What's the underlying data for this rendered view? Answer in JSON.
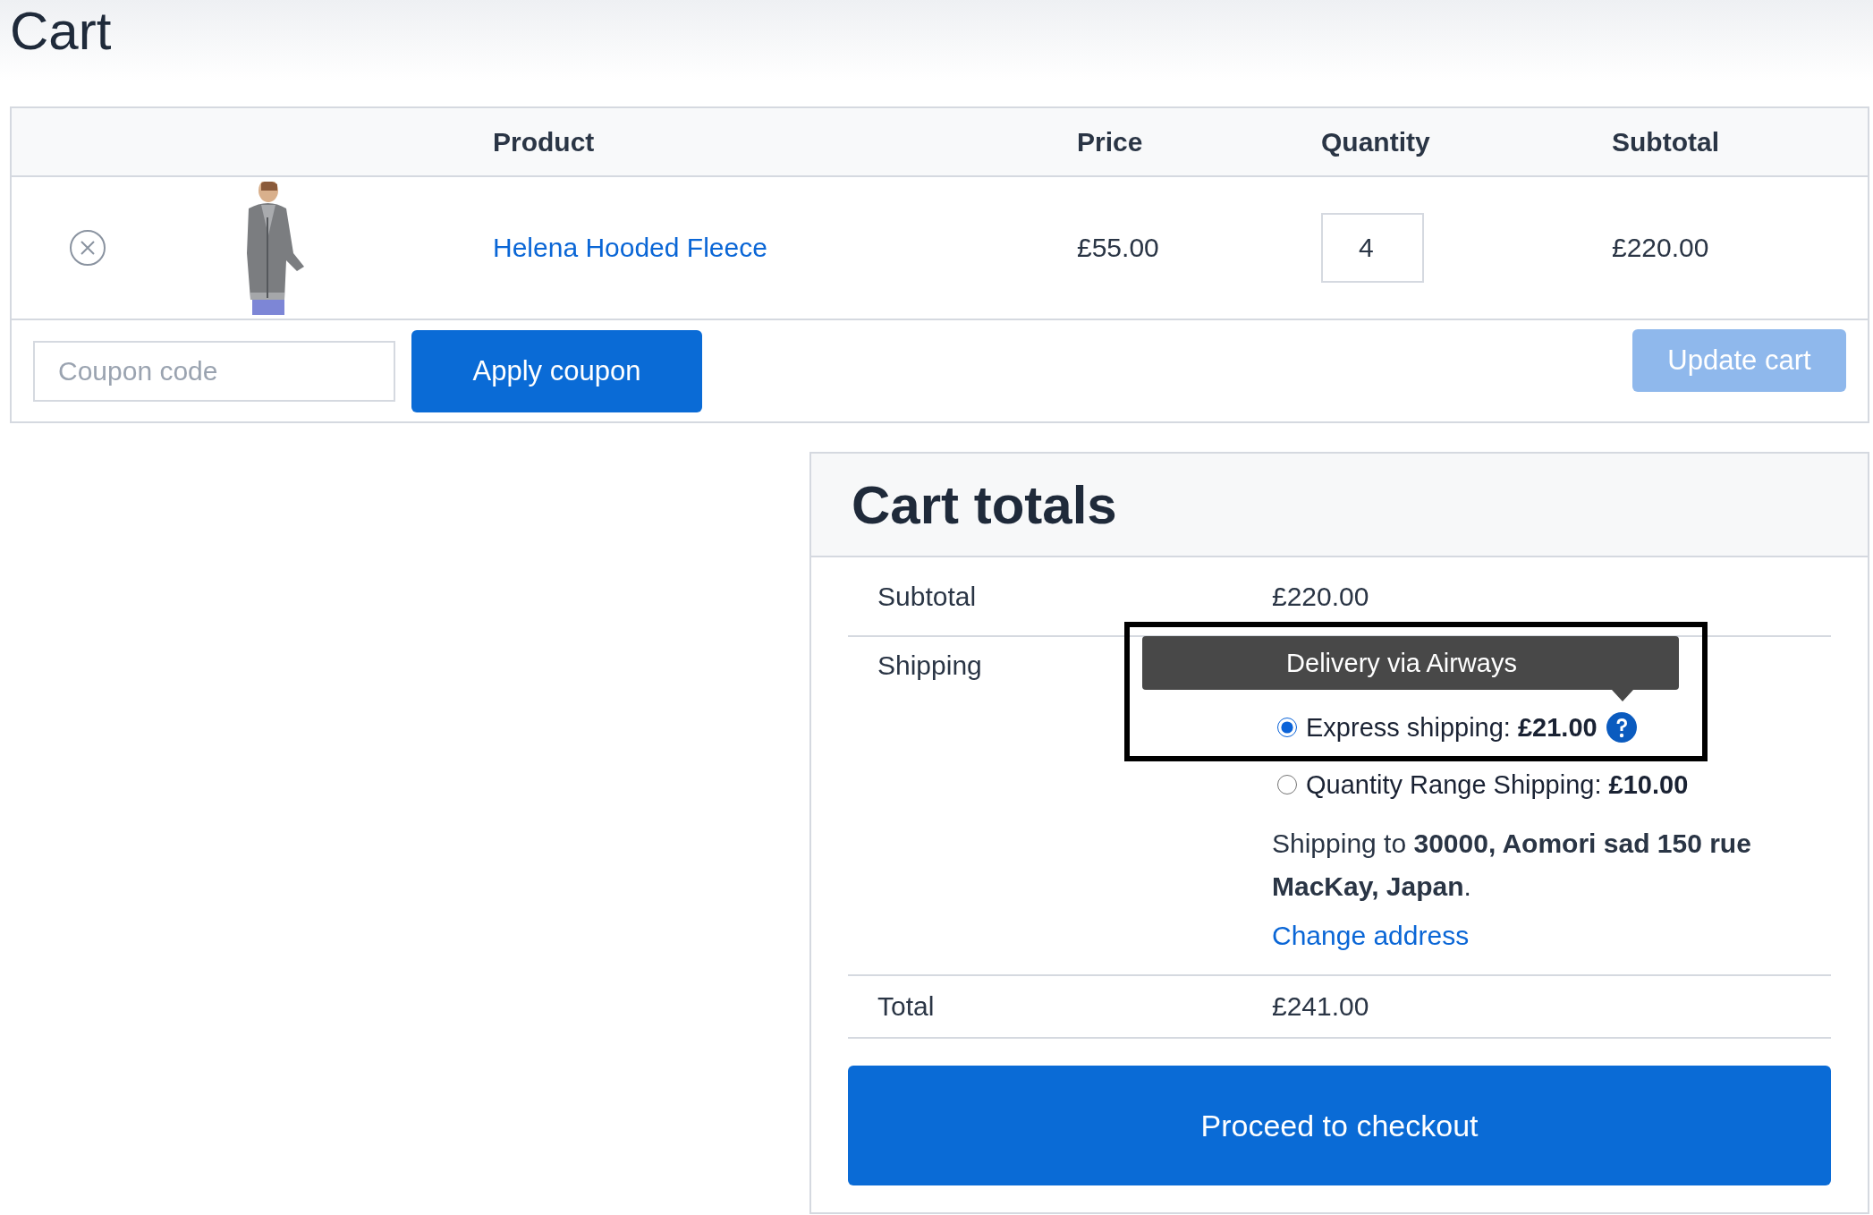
{
  "page_title": "Cart",
  "table": {
    "columns": [
      "Product",
      "Price",
      "Quantity",
      "Subtotal"
    ],
    "rows": [
      {
        "product": "Helena Hooded Fleece",
        "price": "£55.00",
        "quantity": "4",
        "subtotal": "£220.00"
      }
    ]
  },
  "coupon": {
    "placeholder": "Coupon code",
    "apply_button": "Apply coupon"
  },
  "update_button": {
    "label": "Update cart",
    "disabled": true
  },
  "totals": {
    "title": "Cart totals",
    "subtotal_label": "Subtotal",
    "subtotal": "£220.00",
    "shipping_label": "Shipping",
    "shipping_options": [
      {
        "label": "Express shipping: **£21.00**",
        "selected": true,
        "help": true
      },
      {
        "label": "Quantity Range Shipping: **£10.00**",
        "selected": false,
        "help": false
      }
    ],
    "tooltip": "Delivery via Airways",
    "shipping_to": "Shipping to **30000, Aomori sad 150 rue MacKay, Japan**.",
    "change_address": "Change address",
    "total_label": "Total",
    "total": "£241.00",
    "checkout_button": "Proceed to checkout"
  }
}
